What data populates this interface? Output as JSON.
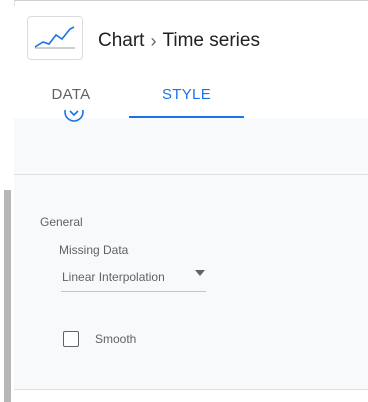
{
  "header": {
    "icon": "time-series-chart-icon",
    "breadcrumb": {
      "parent": "Chart",
      "separator": "›",
      "current": "Time series"
    }
  },
  "tabs": [
    {
      "label": "DATA",
      "active": false
    },
    {
      "label": "STYLE",
      "active": true
    }
  ],
  "colors": {
    "accent": "#1a73e8",
    "panel_bg": "#f8f9fa"
  },
  "style_panel": {
    "section_title": "General",
    "missing_data": {
      "label": "Missing Data",
      "value": "Linear Interpolation"
    },
    "smooth": {
      "label": "Smooth",
      "checked": false
    }
  }
}
